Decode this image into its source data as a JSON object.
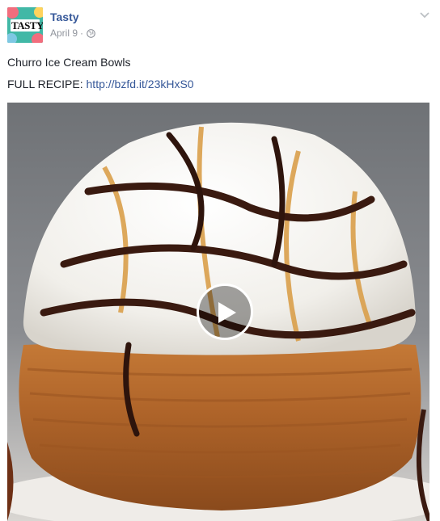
{
  "post": {
    "page_name": "Tasty",
    "avatar_text": "TASTY",
    "date": "April 9",
    "separator": "·",
    "title": "Churro Ice Cream Bowls",
    "recipe_prefix": "FULL RECIPE: ",
    "recipe_link": "http://bzfd.it/23kHxS0"
  },
  "icons": {
    "globe": "globe-icon",
    "options": "chevron-down-icon",
    "play": "play-icon"
  },
  "colors": {
    "link": "#365899",
    "meta": "#90949c",
    "text": "#1d2129"
  }
}
